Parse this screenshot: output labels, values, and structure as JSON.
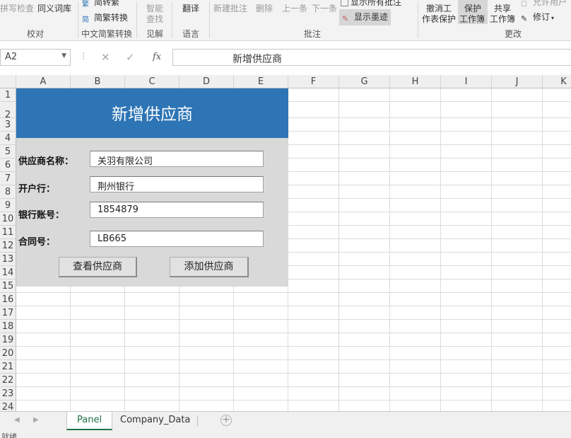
{
  "ribbon": {
    "spellcheck": "拼写检查",
    "thesaurus": "同义词库",
    "group_proofing": "校对",
    "to_simplified": "简转繁",
    "convert_trad_simp": "简繁转换",
    "group_chinese_conv": "中文简繁转换",
    "smart_lookup_1": "智能",
    "smart_lookup_2": "查找",
    "group_insights": "见解",
    "translate": "翻译",
    "group_language": "语言",
    "new_comment": "新建批注",
    "delete": "删除",
    "previous": "上一条",
    "next": "下一条",
    "show_all_comments": "显示所有批注",
    "show_ink": "显示墨迹",
    "group_comments": "批注",
    "unprotect_sheet_1": "撤消工",
    "unprotect_sheet_2": "作表保护",
    "protect_workbook_1": "保护",
    "protect_workbook_2": "工作簿",
    "share_workbook_1": "共享",
    "share_workbook_2": "工作簿",
    "allow_users": "允许用户",
    "track_changes": "修订",
    "group_changes": "更改"
  },
  "formula_bar": {
    "name_box": "A2",
    "cancel_icon": "✕",
    "enter_icon": "✓",
    "fx_label": "fx",
    "content": "新增供应商"
  },
  "columns": [
    "A",
    "B",
    "C",
    "D",
    "E",
    "F",
    "G",
    "H",
    "I",
    "J",
    "K"
  ],
  "rows": [
    "1",
    "2",
    "3",
    "4",
    "5",
    "6",
    "7",
    "8",
    "9",
    "10",
    "11",
    "12",
    "13",
    "14",
    "15",
    "16",
    "17",
    "18",
    "19",
    "20",
    "21",
    "22",
    "23",
    "24"
  ],
  "panel": {
    "title": "新增供应商",
    "supplier_name_label": "供应商名称：",
    "supplier_name_value": "关羽有限公司",
    "bank_label": "开户行：",
    "bank_value": "荆州银行",
    "account_label": "银行账号：",
    "account_value": "1854879",
    "contract_label": "合同号：",
    "contract_value": "LB665",
    "view_button": "查看供应商",
    "add_button": "添加供应商",
    "title_bg": "#2e75b6",
    "panel_bg": "#d9d9d9"
  },
  "tabs": {
    "sheet1": "Panel",
    "sheet2": "Company_Data",
    "active_color": "#217346"
  },
  "status": {
    "ready": "就绪"
  }
}
